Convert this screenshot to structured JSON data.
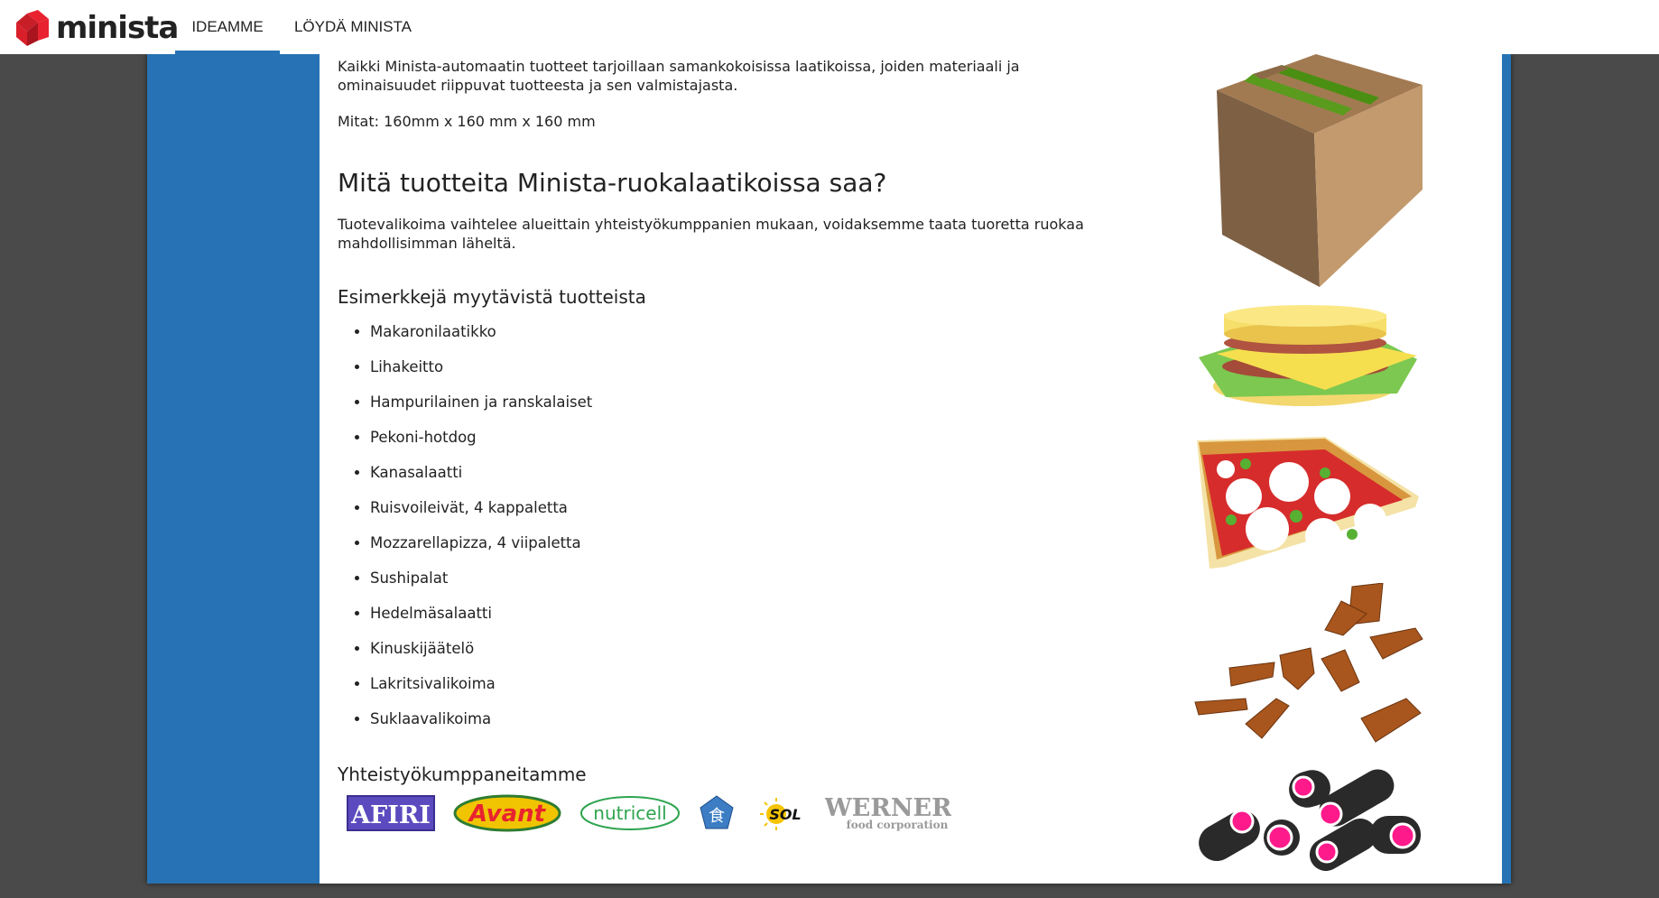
{
  "header": {
    "logo_text": "minista",
    "nav": [
      {
        "label": "IDEAMME",
        "active": true
      },
      {
        "label": "LÖYDÄ MINISTA",
        "active": false
      }
    ]
  },
  "main": {
    "intro": "Kaikki Minista-automaatin tuotteet tarjoillaan samankokoisissa laatikoissa, joiden materiaali ja ominaisuudet riippuvat tuotteesta ja sen valmistajasta.",
    "dimensions": "Mitat: 160mm x 160 mm x 160 mm",
    "heading": "Mitä tuotteita Minista-ruokalaatikoissa saa?",
    "selection_text": "Tuotevalikoima vaihtelee alueittain yhteistyökumppanien mukaan, voidaksemme taata tuoretta ruokaa mahdollisimman läheltä.",
    "examples_heading": "Esimerkkejä myytävistä tuotteista",
    "products": [
      "Makaronilaatikko",
      "Lihakeitto",
      "Hampurilainen ja ranskalaiset",
      "Pekoni-hotdog",
      "Kanasalaatti",
      "Ruisvoileivät, 4 kappaletta",
      "Mozzarellapizza, 4 viipaletta",
      "Sushipalat",
      "Hedelmäsalaatti",
      "Kinuskijäätelö",
      "Lakritsivalikoima",
      "Suklaavalikoima"
    ],
    "partners_heading": "Yhteistyökumppaneitamme",
    "partners": [
      "AFIRI",
      "Avant",
      "nutricell",
      "食",
      "SOL",
      "WERNER",
      "food corporation"
    ]
  },
  "colors": {
    "accent_blue": "#2672b4",
    "background_dark": "#4a4a4a",
    "logo_red": "#e8232f"
  },
  "illustrations": [
    "cardboard-box-icon",
    "burger-icon",
    "pizza-slice-icon",
    "chocolate-pieces-icon",
    "licorice-icon"
  ]
}
